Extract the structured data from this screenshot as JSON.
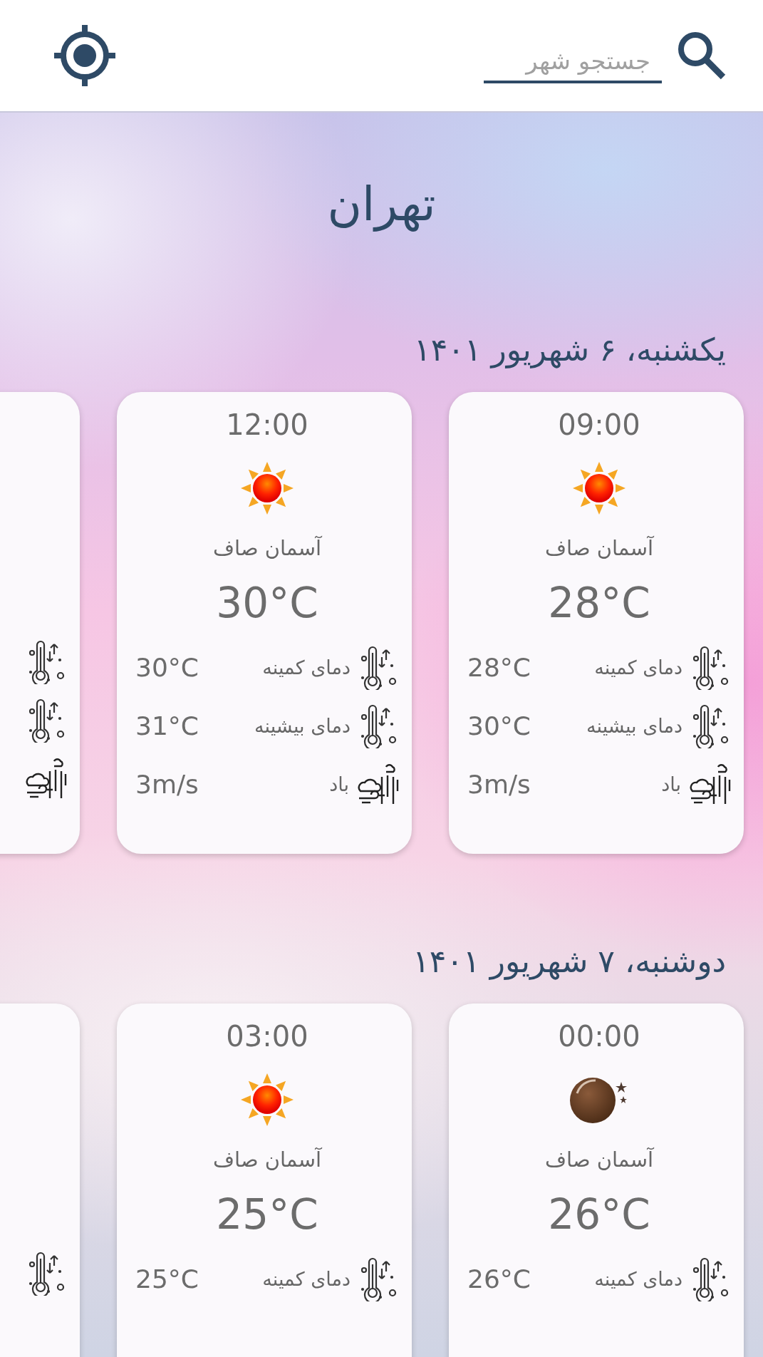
{
  "search": {
    "placeholder": "جستجو شهر"
  },
  "city": "تهران",
  "days": [
    {
      "date": "یکشنبه، ۶ شهریور ۱۴۰۱",
      "forecasts": [
        {
          "time": "09:00",
          "kind": "sun",
          "condition": "آسمان صاف",
          "temp": "28°C",
          "details": [
            {
              "kind": "temp",
              "label": "دمای کمینه",
              "value": "28°C"
            },
            {
              "kind": "temp",
              "label": "دمای بیشینه",
              "value": "30°C"
            },
            {
              "kind": "wind",
              "label": "باد",
              "value": "3m/s"
            }
          ]
        },
        {
          "time": "12:00",
          "kind": "sun",
          "condition": "آسمان صاف",
          "temp": "30°C",
          "details": [
            {
              "kind": "temp",
              "label": "دمای کمینه",
              "value": "30°C"
            },
            {
              "kind": "temp",
              "label": "دمای بیشینه",
              "value": "31°C"
            },
            {
              "kind": "wind",
              "label": "باد",
              "value": "3m/s"
            }
          ]
        },
        {
          "kind": "partial",
          "details": [
            {
              "kind": "temp"
            },
            {
              "kind": "temp"
            },
            {
              "kind": "wind"
            }
          ]
        }
      ]
    },
    {
      "date": "دوشنبه، ۷ شهریور ۱۴۰۱",
      "forecasts": [
        {
          "time": "00:00",
          "kind": "moon",
          "condition": "آسمان صاف",
          "temp": "26°C",
          "details": [
            {
              "kind": "temp",
              "label": "دمای کمینه",
              "value": "26°C"
            }
          ]
        },
        {
          "time": "03:00",
          "kind": "sun",
          "condition": "آسمان صاف",
          "temp": "25°C",
          "details": [
            {
              "kind": "temp",
              "label": "دمای کمینه",
              "value": "25°C"
            }
          ]
        },
        {
          "kind": "partial",
          "details": [
            {
              "kind": "temp"
            }
          ]
        }
      ]
    }
  ]
}
